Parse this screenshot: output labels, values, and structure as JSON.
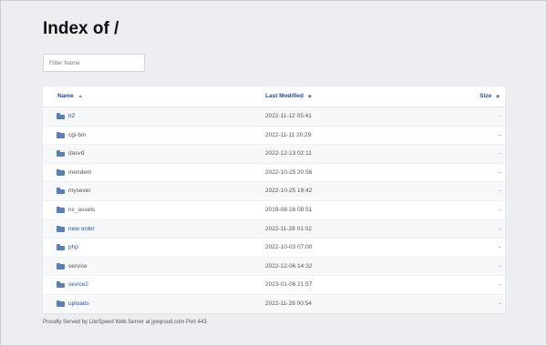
{
  "page": {
    "title": "Index of /",
    "filter_placeholder": "Filter Name",
    "footer": "Proudly Served by LiteSpeed Web Server at jyeqroud.com Port 443"
  },
  "table": {
    "headers": {
      "name": "Name",
      "name_sort": "▲",
      "modified": "Last Modified",
      "modified_sort": "◆",
      "size": "Size",
      "size_sort": "◆"
    },
    "rows": [
      {
        "name": "b2",
        "modified": "2022-11-12 05:41",
        "size": "-",
        "link": true
      },
      {
        "name": "cgi-bin",
        "modified": "2022-11-11 20:29",
        "size": "-",
        "link": false
      },
      {
        "name": "dasvd",
        "modified": "2022-12-13 02:11",
        "size": "-",
        "link": false
      },
      {
        "name": "mendem",
        "modified": "2022-10-25 20:56",
        "size": "-",
        "link": false
      },
      {
        "name": "mysever",
        "modified": "2022-10-25 19:42",
        "size": "-",
        "link": false
      },
      {
        "name": "nc_assets",
        "modified": "2019-08-16 08:51",
        "size": "-",
        "link": false
      },
      {
        "name": "new order",
        "modified": "2022-11-28 01:02",
        "size": "-",
        "link": true
      },
      {
        "name": "php",
        "modified": "2022-10-03 07:00",
        "size": "-",
        "link": true
      },
      {
        "name": "service",
        "modified": "2022-12-06 14:32",
        "size": "-",
        "link": false
      },
      {
        "name": "sevice2",
        "modified": "2023-01-06 21:57",
        "size": "-",
        "link": true
      },
      {
        "name": "uploads",
        "modified": "2022-11-28 00:54",
        "size": "-",
        "link": true
      }
    ]
  },
  "icons": {
    "folder": "folder-icon"
  },
  "colors": {
    "background": "#eceef1",
    "header_link": "#2a4b8d",
    "row_link": "#2a58a8",
    "folder_icon": "#5b7fb5"
  }
}
